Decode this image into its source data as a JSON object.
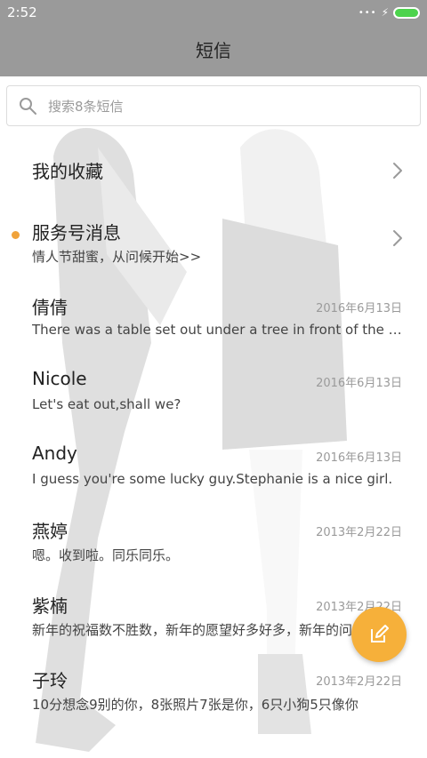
{
  "status_bar": {
    "time": "2:52",
    "dots_icon": "more-dots-icon",
    "charging_icon": "bolt-icon",
    "battery_icon": "battery-icon"
  },
  "app_bar": {
    "title": "短信"
  },
  "search": {
    "placeholder": "搜索8条短信"
  },
  "conversations": [
    {
      "name": "我的收藏",
      "preview": "",
      "date": "",
      "chevron": true,
      "unread": false
    },
    {
      "name": "服务号消息",
      "preview": "情人节甜蜜，从问候开始>>",
      "date": "",
      "chevron": true,
      "unread": true
    },
    {
      "name": "倩倩",
      "preview": "There was a table set out under a tree in front of the ho...",
      "date": "2016年6月13日",
      "chevron": false,
      "unread": false
    },
    {
      "name": "Nicole",
      "preview": "Let's eat out,shall we?",
      "date": "2016年6月13日",
      "chevron": false,
      "unread": false
    },
    {
      "name": "Andy",
      "preview": "I guess you're some lucky guy.Stephanie is a nice girl.",
      "date": "2016年6月13日",
      "chevron": false,
      "unread": false
    },
    {
      "name": "燕婷",
      "preview": "嗯。收到啦。同乐同乐。",
      "date": "2013年2月22日",
      "chevron": false,
      "unread": false
    },
    {
      "name": "紫楠",
      "preview": "新年的祝福数不胜数，新年的愿望好多好多，新年的问候...",
      "date": "2013年2月22日",
      "chevron": false,
      "unread": false
    },
    {
      "name": "子玲",
      "preview": "10分想念9别的你，8张照片7张是你，6只小狗5只像你",
      "date": "2013年2月22日",
      "chevron": false,
      "unread": false
    }
  ],
  "colors": {
    "app_bar": "#9a9a9a",
    "unread_dot": "#f0a33b",
    "fab": "#f6b03a",
    "battery": "#4cd34c"
  },
  "fab": {
    "icon": "compose-icon"
  }
}
